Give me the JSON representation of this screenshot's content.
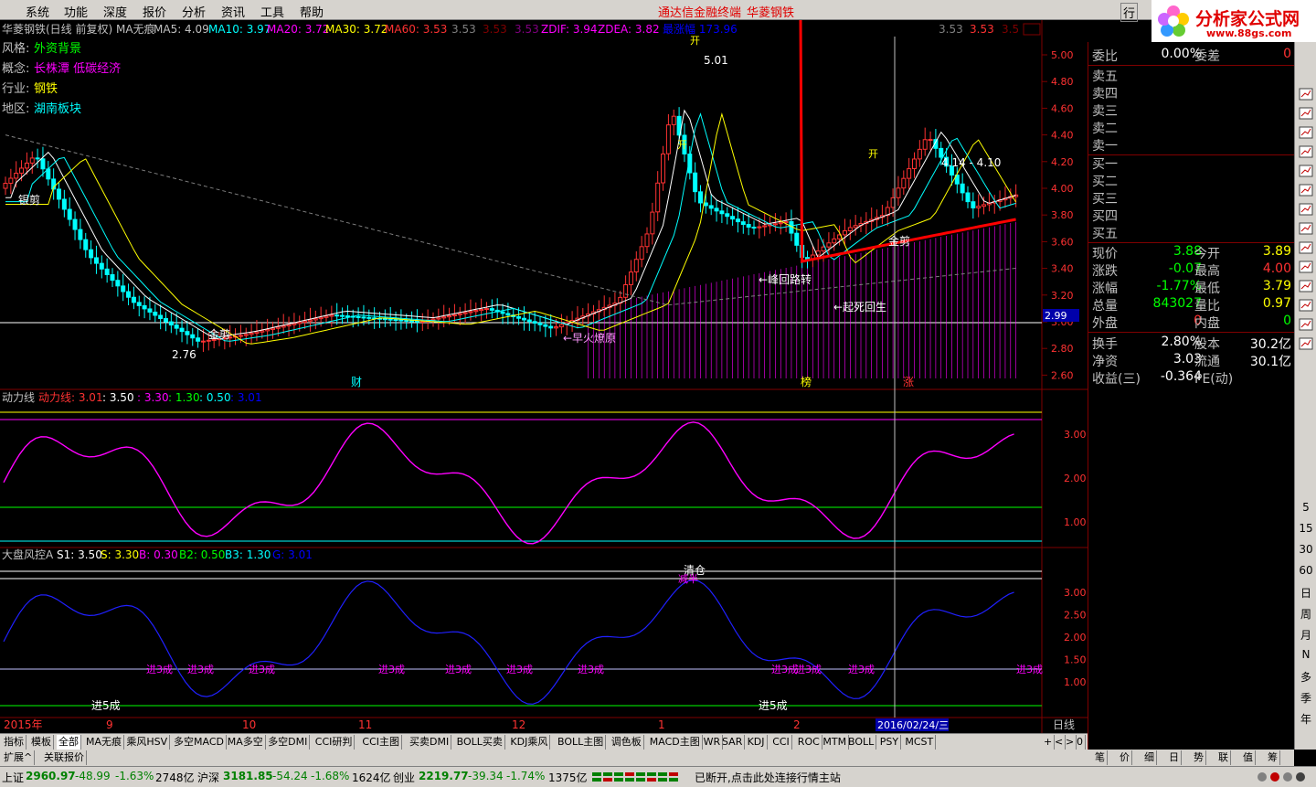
{
  "menu": [
    "系统",
    "功能",
    "深度",
    "报价",
    "分析",
    "资讯",
    "工具",
    "帮助"
  ],
  "menu_center": [
    "通达信金融终端",
    "华菱钢铁"
  ],
  "menu_right": "行",
  "logo": {
    "title": "分析家公式网",
    "url": "www.88gs.com"
  },
  "header": {
    "title": "华菱钢铁(日线 前复权) MA无痕",
    "ma5": "MA5: 4.09",
    "ma10": "MA10: 3.97",
    "ma20": "MA20: 3.72",
    "ma30": "MA30: 3.72",
    "ma60": "MA60: 3.53",
    "v1": "3.53",
    "v2": "3.53",
    "v3": "3.53",
    "zdif": "ZDIF: 3.94",
    "zdea": "ZDEA: 3.82",
    "zf": "最涨幅 173.96",
    "r1": "3.53",
    "r2": "3.53",
    "r3": "3.5"
  },
  "info": [
    {
      "k": "风格:",
      "v": "外资背景"
    },
    {
      "k": "概念:",
      "v": "长株潭 低碳经济"
    },
    {
      "k": "行业:",
      "v": "钢铁"
    },
    {
      "k": "地区:",
      "v": "湖南板块"
    }
  ],
  "main_axis": [
    "5.00",
    "4.80",
    "4.60",
    "4.40",
    "4.20",
    "4.00",
    "3.80",
    "3.60",
    "3.40",
    "3.20",
    "3.00",
    "2.80",
    "2.60"
  ],
  "price_tag": "2.99",
  "annotations": {
    "hi": "5.01",
    "lo": "2.76",
    "range": "4.14 - 4.10",
    "gold1": "金剪",
    "gold2": "银剪",
    "gold3": "金剪",
    "peak": "←峰回路转",
    "rise": "←起死回生",
    "star": "←早火燎原",
    "kai1": "开",
    "kai2": "开",
    "kai3": "开",
    "m1": "财",
    "m2": "榜",
    "m3": "涨"
  },
  "ind1": {
    "title": "动力线",
    "label": "动力线: 3.01",
    "a": ": 3.50",
    "b": ": 3.30",
    "c": ": 1.30",
    "d": ": 0.50",
    "e": ": 3.01",
    "axis": [
      "3.00",
      "2.00",
      "1.00"
    ]
  },
  "ind2": {
    "title": "大盘风控A",
    "s1": "S1: 3.50",
    "s": "S: 3.30",
    "b": "B: 0.30",
    "b2": "B2: 0.50",
    "b3": "B3: 1.30",
    "g": "G: 3.01",
    "axis": [
      "3.00",
      "2.50",
      "2.00",
      "1.50",
      "1.00"
    ],
    "jin3": "进3成",
    "jin5": "进5成",
    "qingcang": "清仓",
    "jian": "减半"
  },
  "xaxis": {
    "year": "2015年",
    "m9": "9",
    "m10": "10",
    "m11": "11",
    "m12": "12",
    "m1": "1",
    "m2": "2",
    "cursor": "2016/02/24/三",
    "period": "日线"
  },
  "quote": {
    "wb_label": "委比",
    "wb": "0.00%",
    "wc_label": "委差",
    "wc": "0",
    "sells": [
      "卖五",
      "卖四",
      "卖三",
      "卖二",
      "卖一"
    ],
    "buys": [
      "买一",
      "买二",
      "买三",
      "买四",
      "买五"
    ],
    "rows": [
      [
        "现价",
        "3.88",
        "今开",
        "3.89"
      ],
      [
        "涨跌",
        "-0.07",
        "最高",
        "4.00"
      ],
      [
        "涨幅",
        "-1.77%",
        "最低",
        "3.79"
      ],
      [
        "总量",
        "843027",
        "量比",
        "0.97"
      ],
      [
        "外盘",
        "0",
        "内盘",
        "0"
      ],
      [
        "换手",
        "2.80%",
        "股本",
        "30.2亿"
      ],
      [
        "净资",
        "3.03",
        "流通",
        "30.1亿"
      ],
      [
        "收益(三)",
        "-0.364",
        "PE(动)",
        ""
      ]
    ]
  },
  "tabs": [
    "指标",
    "模板",
    "全部",
    "MA无痕",
    "乘风HSV",
    "多空MACD",
    "MA多空",
    "多空DMI",
    "CCI研判",
    "CCI主图",
    "买卖DMI",
    "BOLL买卖",
    "KDJ乘风",
    "BOLL主图",
    "调色板",
    "MACD主图",
    "WR",
    "SAR",
    "KDJ",
    "CCI",
    "ROC",
    "MTM",
    "BOLL",
    "PSY",
    "MCST"
  ],
  "tabs2": [
    "扩展^",
    "关联报价"
  ],
  "rtabs": [
    "笔",
    "价",
    "细",
    "日",
    "势",
    "联",
    "值",
    "筹"
  ],
  "vtools": [
    "5",
    "15",
    "30",
    "60",
    "日",
    "周",
    "月",
    "N",
    "多",
    "季",
    "年"
  ],
  "status": {
    "sh_label": "上证",
    "sh": "2960.97",
    "sh_ch": "-48.99",
    "sh_pct": "-1.63%",
    "sh_amt": "2748亿",
    "sz_label": "沪深",
    "sz": "3181.85",
    "sz_ch": "-54.24",
    "sz_pct": "-1.68%",
    "sz_amt": "1624亿",
    "cy_label": "创业",
    "cy": "2219.77",
    "cy_ch": "-39.34",
    "cy_pct": "-1.74%",
    "cy_amt": "1375亿",
    "msg": "已断开,点击此处连接行情主站"
  },
  "colors": {
    "up": "#ff3232",
    "down": "#00ffff",
    "magenta": "#ff00ff",
    "green": "#00ff00",
    "yellow": "#ffff00"
  }
}
